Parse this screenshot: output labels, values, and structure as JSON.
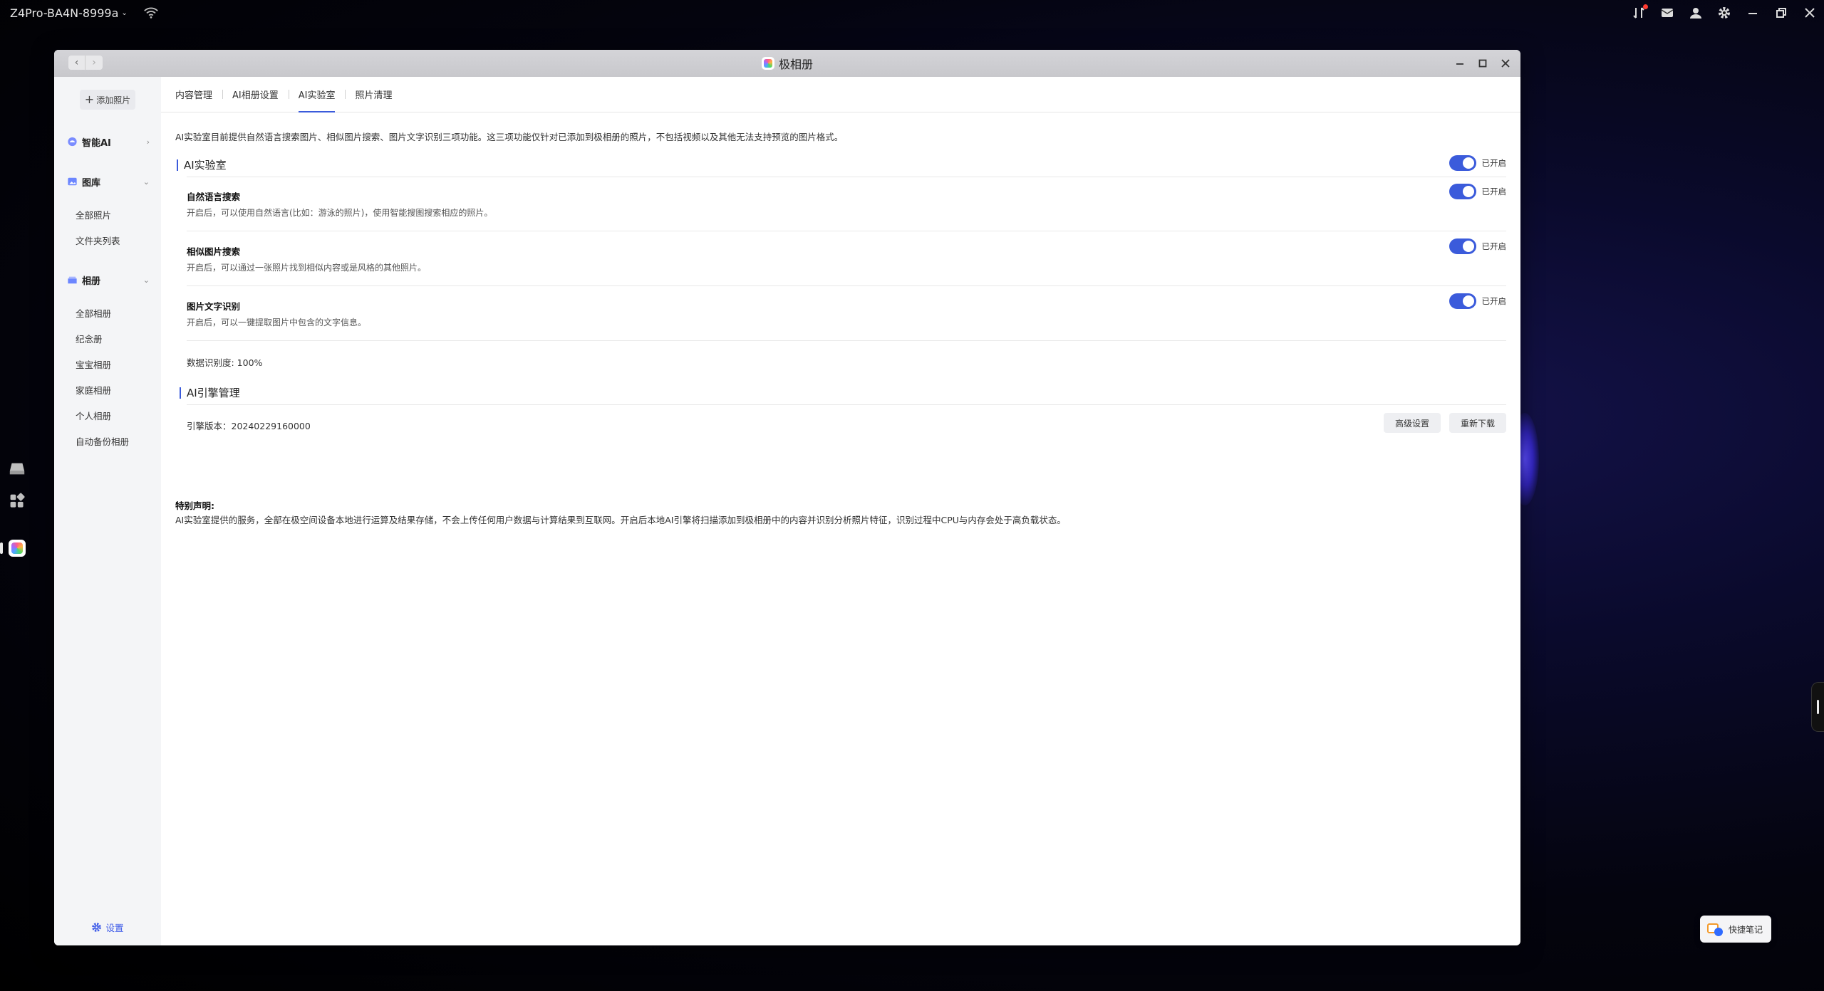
{
  "system_bar": {
    "device_name": "Z4Pro-BA4N-8999a",
    "icons": [
      "wifi-icon",
      "transfer-icon",
      "mail-icon",
      "user-icon",
      "gear-icon",
      "minimize-icon",
      "restore-icon",
      "close-icon"
    ]
  },
  "dock": {
    "icons": [
      "drive-icon",
      "apps-grid-icon",
      "photo-album-app-icon"
    ]
  },
  "window": {
    "title": "极相册",
    "controls": [
      "minimize-icon",
      "maximize-icon",
      "close-icon"
    ]
  },
  "sidebar": {
    "add_label": "添加照片",
    "smart_ai": "智能AI",
    "library": {
      "label": "图库",
      "items": [
        "全部照片",
        "文件夹列表"
      ]
    },
    "albums": {
      "label": "相册",
      "items": [
        "全部相册",
        "纪念册",
        "宝宝相册",
        "家庭相册",
        "个人相册",
        "自动备份相册"
      ]
    },
    "settings_label": "设置"
  },
  "tabs": [
    "内容管理",
    "AI相册设置",
    "AI实验室",
    "照片清理"
  ],
  "active_tab": "AI实验室",
  "content": {
    "intro": "AI实验室目前提供自然语言搜索图片、相似图片搜索、图片文字识别三项功能。这三项功能仅针对已添加到极相册的照片，不包括视频以及其他无法支持预览的图片格式。",
    "lab": {
      "title": "AI实验室",
      "toggle_label": "已开启",
      "features": [
        {
          "title": "自然语言搜索",
          "desc": "开启后，可以使用自然语言(比如：游泳的照片)，使用智能搜图搜索相应的照片。",
          "state": "已开启"
        },
        {
          "title": "相似图片搜索",
          "desc": "开启后，可以通过一张照片找到相似内容或是风格的其他照片。",
          "state": "已开启"
        },
        {
          "title": "图片文字识别",
          "desc": "开启后，可以一键提取图片中包含的文字信息。",
          "state": "已开启"
        }
      ],
      "progress_text": "数据识别度: 100%"
    },
    "engine": {
      "title": "AI引擎管理",
      "version_text": "引擎版本：20240229160000",
      "advanced_button": "高级设置",
      "redownload_button": "重新下载"
    },
    "notice": {
      "title": "特别声明:",
      "text": "AI实验室提供的服务，全部在极空间设备本地进行运算及结果存储，不会上传任何用户数据与计算结果到互联网。开启后本地AI引擎将扫描添加到极相册中的内容并识别分析照片特征，识别过程中CPU与内存会处于高负载状态。"
    }
  },
  "quick_note": "快捷笔记",
  "colors": {
    "accent": "#3b5bdb",
    "toggle_on": "#3b5bdb",
    "desktop_bg": "#04040e"
  }
}
